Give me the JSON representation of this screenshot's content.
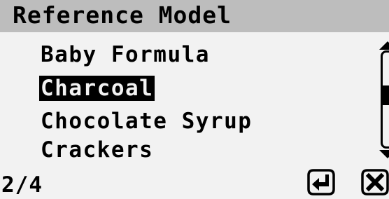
{
  "header": {
    "title": "Reference Model"
  },
  "menu": {
    "items": [
      {
        "label": "Baby Formula",
        "selected": false
      },
      {
        "label": "Charcoal",
        "selected": true
      },
      {
        "label": "Chocolate Syrup",
        "selected": false
      },
      {
        "label": "Crackers",
        "selected": false
      }
    ]
  },
  "footer": {
    "page_indicator": "2/4",
    "softkeys": [
      {
        "icon": "enter-icon"
      },
      {
        "icon": "cancel-icon"
      }
    ]
  },
  "colors": {
    "header_background": "#bdbdbd",
    "screen_background": "#f2f2f2",
    "selected_background": "#000000",
    "selected_text": "#f2f2f2"
  }
}
